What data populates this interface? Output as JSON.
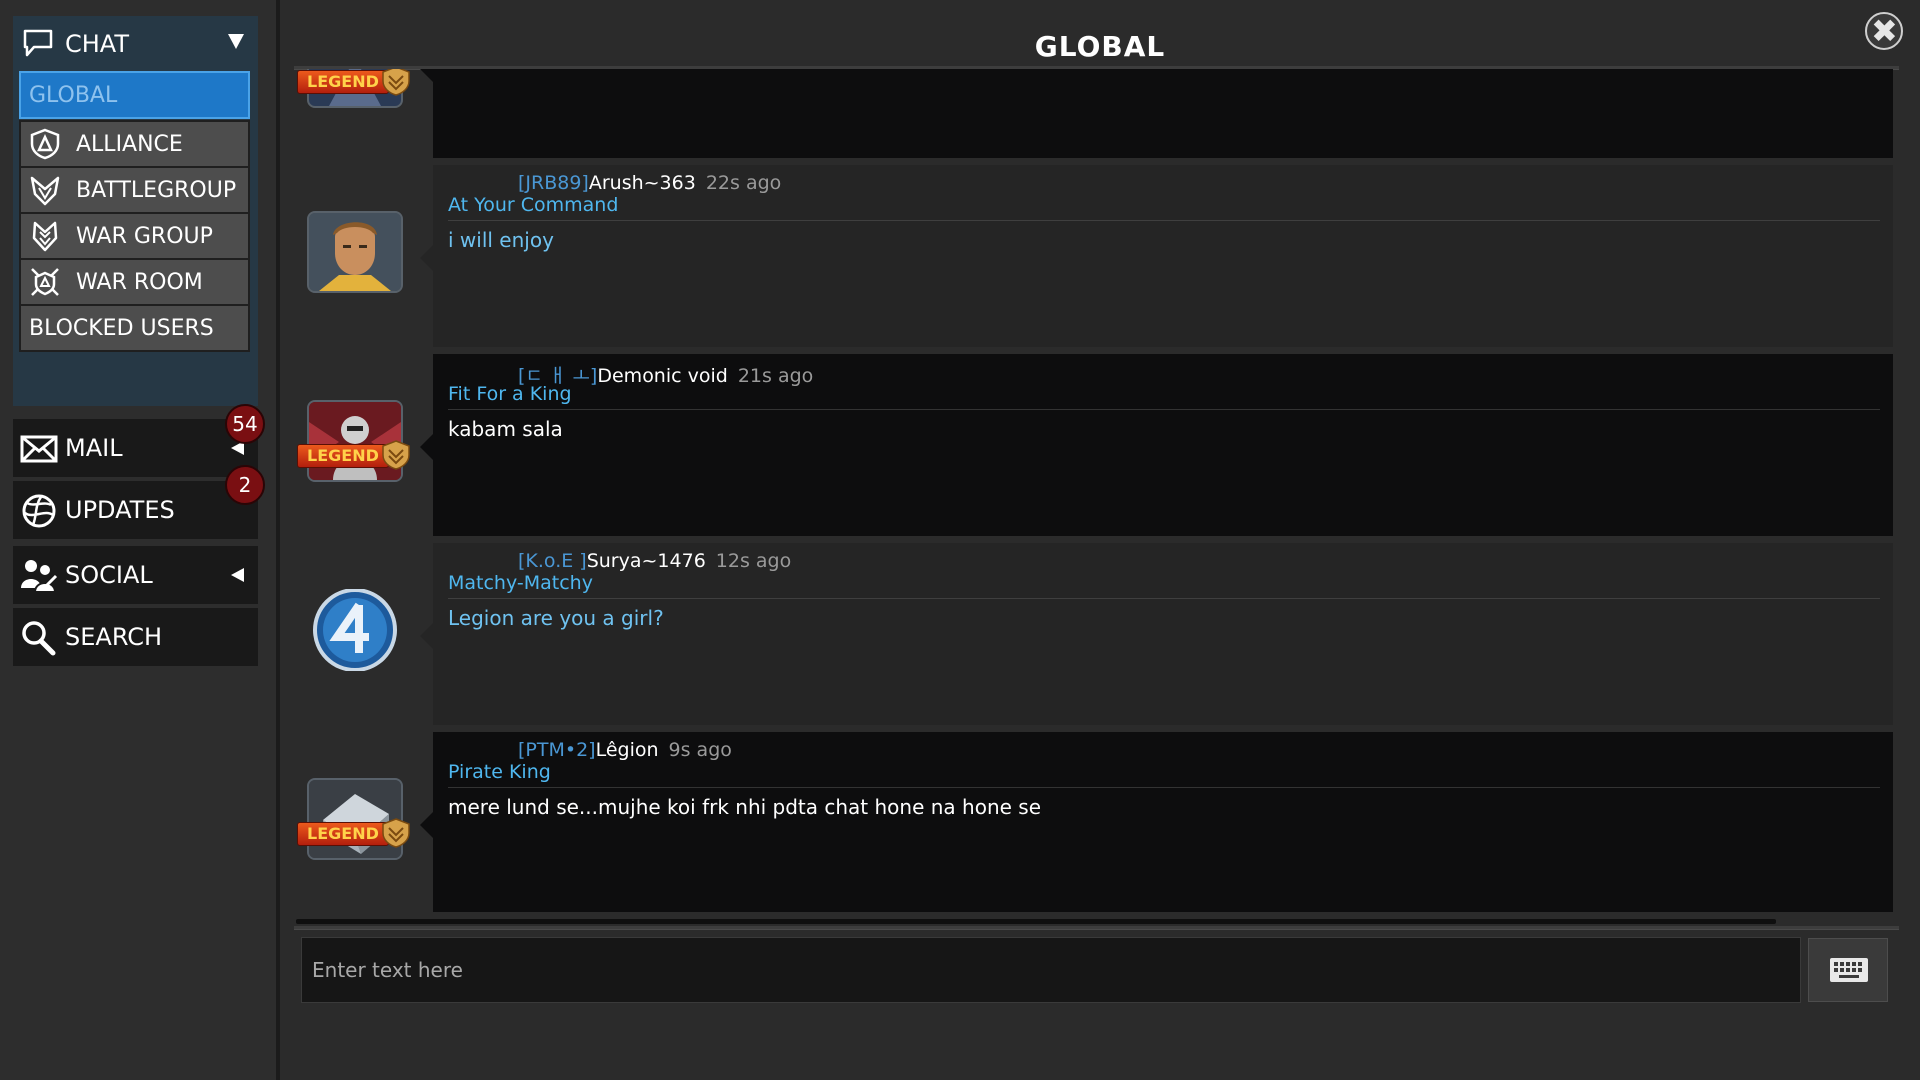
{
  "sidebar": {
    "chat": {
      "label": "CHAT",
      "icon": "chat-bubble-icon",
      "channels": [
        {
          "label": "GLOBAL",
          "active": true
        },
        {
          "label": "ALLIANCE",
          "icon": "alliance-shield-icon"
        },
        {
          "label": "BATTLEGROUP",
          "icon": "battlegroup-icon"
        },
        {
          "label": "WAR GROUP",
          "icon": "war-group-icon"
        },
        {
          "label": "WAR ROOM",
          "icon": "war-room-icon"
        },
        {
          "label": "BLOCKED USERS"
        }
      ]
    },
    "menu": [
      {
        "label": "MAIL",
        "icon": "mail-icon",
        "badge": "54"
      },
      {
        "label": "UPDATES",
        "icon": "globe-icon",
        "badge": "2"
      },
      {
        "label": "SOCIAL",
        "icon": "social-icon"
      },
      {
        "label": "SEARCH",
        "icon": "search-icon"
      }
    ]
  },
  "main": {
    "title": "GLOBAL",
    "messages": [
      {
        "legend": "LEGEND",
        "tag": "",
        "user": "",
        "time": "",
        "user_title": "",
        "text": ""
      },
      {
        "tag": "[JRB89]",
        "user": "Arush~363",
        "time": "22s ago",
        "user_title": "At Your Command",
        "text": "i will enjoy",
        "text_color": "#6fc2f0"
      },
      {
        "tag": "[ㄷ ㅐ ㅗ]",
        "user": "Demonic void",
        "time": "21s ago",
        "user_title": "Fit For a King",
        "text": "kabam sala",
        "legend": "LEGEND",
        "text_color": "#ffffff"
      },
      {
        "tag": "[K.o.E ]",
        "user": "Surya~1476",
        "time": "12s ago",
        "user_title": "Matchy-Matchy",
        "text": "Legion are you a girl?",
        "text_color": "#6fc2f0"
      },
      {
        "tag": "[PTM•2]",
        "user": "Lêgion",
        "time": "9s ago",
        "user_title": "Pirate King",
        "text": "mere lund se...mujhe koi frk nhi pdta chat hone na hone se",
        "legend": "LEGEND",
        "text_color": "#ffffff"
      }
    ],
    "input_placeholder": "Enter text here"
  },
  "colors": {
    "accent_blue": "#1e78c8",
    "tag_blue": "#4a97d4",
    "title_cyan": "#4fb7ef",
    "badge_red": "#7a0f12"
  }
}
